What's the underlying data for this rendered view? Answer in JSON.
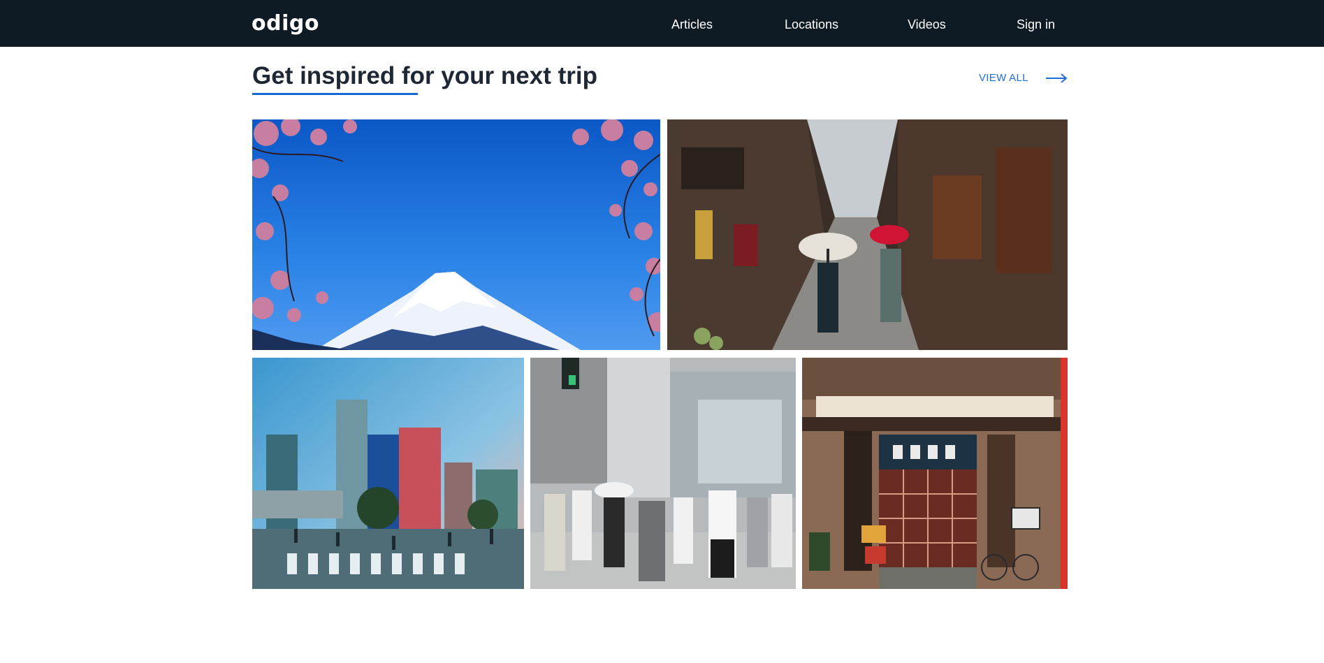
{
  "header": {
    "logo": "odigo",
    "nav": [
      {
        "label": "Articles"
      },
      {
        "label": "Locations"
      },
      {
        "label": "Videos"
      },
      {
        "label": "Sign in"
      }
    ]
  },
  "section": {
    "title": "Get inspired for your next trip",
    "view_all": "VIEW ALL",
    "arrow_icon": "arrow-right-icon"
  },
  "colors": {
    "header_bg": "#0f1b24",
    "accent": "#1769d1",
    "link": "#1f6fd6"
  },
  "tiles": [
    {
      "subject": "mount-fuji-cherry-blossoms"
    },
    {
      "subject": "kyoto-alley-umbrellas"
    },
    {
      "subject": "shibuya-crossing"
    },
    {
      "subject": "street-pedestrians"
    },
    {
      "subject": "japanese-restaurant-storefront"
    }
  ]
}
